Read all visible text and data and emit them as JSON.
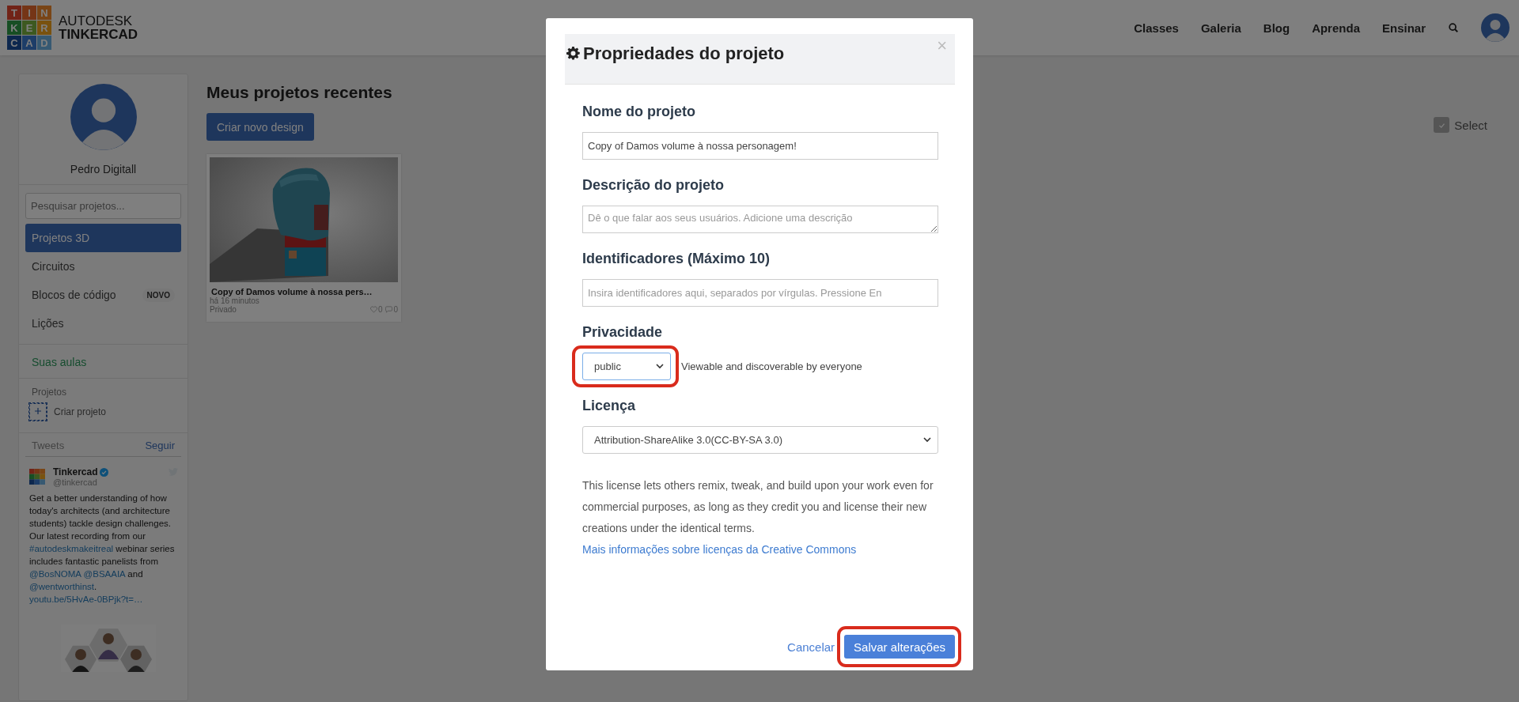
{
  "header": {
    "logo_letters": [
      "T",
      "I",
      "N",
      "K",
      "E",
      "R",
      "C",
      "A",
      "D"
    ],
    "brand_top": "AUTODESK",
    "brand_bottom": "TINKERCAD",
    "nav": [
      "Classes",
      "Galeria",
      "Blog",
      "Aprenda",
      "Ensinar"
    ]
  },
  "sidebar": {
    "user_name": "Pedro Digitall",
    "search": {
      "placeholder": "Pesquisar projetos..."
    },
    "items": [
      {
        "label": "Projetos 3D",
        "selected": true
      },
      {
        "label": "Circuitos",
        "selected": false
      },
      {
        "label": "Blocos de código",
        "selected": false,
        "badge": "NOVO"
      },
      {
        "label": "Lições",
        "selected": false
      }
    ],
    "classes_link": "Suas aulas",
    "projects_heading": "Projetos",
    "create_project": "Criar projeto",
    "tweets": {
      "heading": "Tweets",
      "follow": "Seguir",
      "author": "Tinkercad",
      "verified": true,
      "handle": "@tinkercad",
      "segments": [
        {
          "kind": "text",
          "text": "Get a better understanding of how today's architects (and architecture students) tackle design challenges. Our latest recording from our "
        },
        {
          "kind": "hashtag",
          "text": "#autodeskmakeitreal"
        },
        {
          "kind": "text",
          "text": " webinar series includes fantastic panelists from "
        },
        {
          "kind": "mention",
          "text": "@BosNOMA "
        },
        {
          "kind": "mention",
          "text": "@BSAAIA"
        },
        {
          "kind": "text",
          "text": " and "
        },
        {
          "kind": "mention",
          "text": "@wentworthinst"
        },
        {
          "kind": "text",
          "text": ". "
        },
        {
          "kind": "url",
          "text": "youtu.be/5HvAe-0BPjk?t=…"
        }
      ]
    }
  },
  "main": {
    "title": "Meus projetos recentes",
    "create_button": "Criar novo design",
    "select": {
      "label": "Select",
      "checked": true
    },
    "projects": [
      {
        "title": "Copy of Damos volume à nossa pers…",
        "time": "há 16 minutos",
        "privacy": "Privado",
        "likes": "0",
        "comments": "0"
      }
    ]
  },
  "modal": {
    "title": "Propriedades do projeto",
    "close": "×",
    "fields": [
      {
        "kind": "text",
        "label": "Nome do projeto",
        "value": "Copy of Damos volume à nossa personagem!"
      },
      {
        "kind": "textarea",
        "label": "Descrição do projeto",
        "placeholder": "Dê o que falar aos seus usuários. Adicione uma descrição"
      },
      {
        "kind": "text",
        "label": "Identificadores (Máximo 10)",
        "placeholder": "Insira identificadores aqui, separados por vírgulas. Pressione En"
      },
      {
        "kind": "select",
        "label": "Privacidade",
        "value": "public",
        "note": "Viewable and discoverable by everyone",
        "highlighted": true
      },
      {
        "kind": "select",
        "label": "Licença",
        "value": "Attribution-ShareAlike 3.0(CC-BY-SA 3.0)"
      }
    ],
    "license_text": "This license lets others remix, tweak, and build upon your work even for commercial purposes, as long as they credit you and license their new creations under the identical terms. ",
    "license_link": "Mais informações sobre licenças da Creative Commons",
    "cancel": "Cancelar",
    "save": {
      "label": "Salvar alterações",
      "highlighted": true
    }
  }
}
